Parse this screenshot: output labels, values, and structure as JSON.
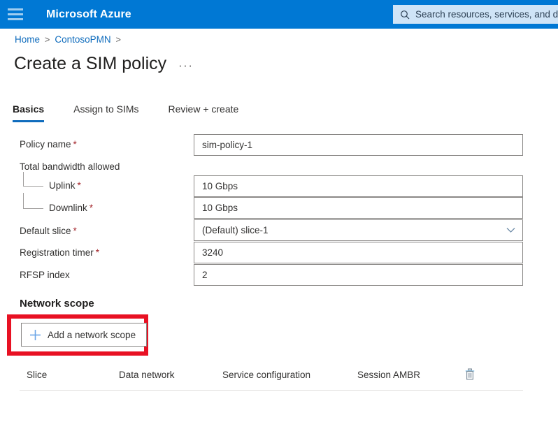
{
  "topbar": {
    "menu_icon": "hamburger-icon",
    "brand": "Microsoft Azure",
    "search": {
      "icon": "search-icon",
      "placeholder": "Search resources, services, and docs"
    },
    "color": "#0078d4"
  },
  "breadcrumb": {
    "items": [
      {
        "label": "Home"
      },
      {
        "label": "ContosoPMN"
      }
    ],
    "separator": ">"
  },
  "page": {
    "title": "Create a SIM policy",
    "more_actions": "···"
  },
  "tabs": [
    {
      "label": "Basics",
      "active": true
    },
    {
      "label": "Assign to SIMs",
      "active": false
    },
    {
      "label": "Review + create",
      "active": false
    }
  ],
  "form": {
    "fields": [
      {
        "label": "Policy name",
        "required": true,
        "value": "sim-policy-1",
        "type": "text"
      },
      {
        "label": "Total bandwidth allowed",
        "required": false,
        "value": "",
        "type": "group"
      },
      {
        "label": "Uplink",
        "required": true,
        "value": "10 Gbps",
        "type": "text"
      },
      {
        "label": "Downlink",
        "required": true,
        "value": "10 Gbps",
        "type": "text"
      },
      {
        "label": "Default slice",
        "required": true,
        "value": "(Default) slice-1",
        "type": "select"
      },
      {
        "label": "Registration timer",
        "required": true,
        "value": "3240",
        "type": "text"
      },
      {
        "label": "RFSP index",
        "required": false,
        "value": "2",
        "type": "text"
      }
    ],
    "required_marker": "*",
    "required_color": "#a4262c"
  },
  "network_scope": {
    "heading": "Network scope",
    "add_button": {
      "label": "Add a network scope",
      "icon": "plus-icon"
    },
    "highlight_color": "#e81123",
    "table": {
      "columns": [
        "Slice",
        "Data network",
        "Service configuration",
        "Session AMBR"
      ],
      "delete_icon": "trash-icon",
      "rows": []
    }
  }
}
